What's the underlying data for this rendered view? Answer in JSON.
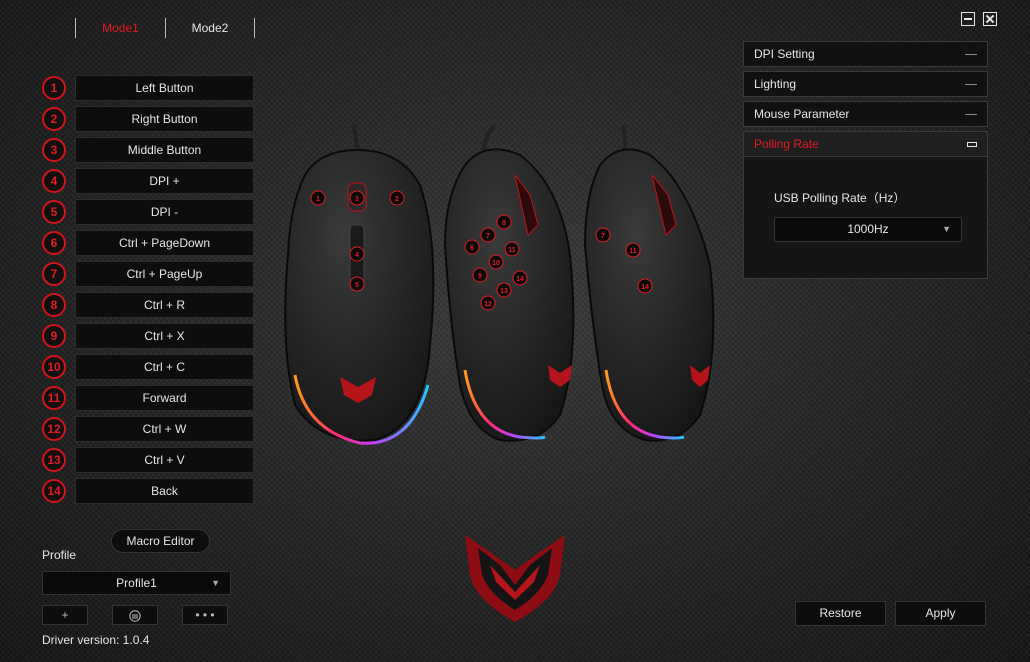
{
  "tabs": [
    {
      "label": "Mode1",
      "active": true
    },
    {
      "label": "Mode2",
      "active": false
    }
  ],
  "buttons": [
    {
      "num": "1",
      "action": "Left Button"
    },
    {
      "num": "2",
      "action": "Right Button"
    },
    {
      "num": "3",
      "action": "Middle Button"
    },
    {
      "num": "4",
      "action": "DPI +"
    },
    {
      "num": "5",
      "action": "DPI -"
    },
    {
      "num": "6",
      "action": "Ctrl + PageDown"
    },
    {
      "num": "7",
      "action": "Ctrl + PageUp"
    },
    {
      "num": "8",
      "action": "Ctrl + R"
    },
    {
      "num": "9",
      "action": "Ctrl + X"
    },
    {
      "num": "10",
      "action": "Ctrl + C"
    },
    {
      "num": "11",
      "action": "Forward"
    },
    {
      "num": "12",
      "action": "Ctrl + W"
    },
    {
      "num": "13",
      "action": "Ctrl + V"
    },
    {
      "num": "14",
      "action": "Back"
    }
  ],
  "mouse_labels": {
    "top": [
      "1",
      "2",
      "3",
      "4",
      "5"
    ],
    "side_left": [
      "6",
      "7",
      "8",
      "9",
      "10",
      "11",
      "12",
      "13",
      "14"
    ],
    "side_right": [
      "7",
      "11",
      "14"
    ]
  },
  "panel": {
    "sections": [
      {
        "label": "DPI Setting"
      },
      {
        "label": "Lighting"
      },
      {
        "label": "Mouse Parameter"
      }
    ],
    "open_section": {
      "label": "Polling Rate",
      "field_label": "USB Polling Rate（Hz）",
      "value": "1000Hz"
    }
  },
  "macro_label": "Macro Editor",
  "profile": {
    "label": "Profile",
    "value": "Profile1",
    "add_label": "+",
    "more_label": "• • •"
  },
  "version": "Driver version: 1.0.4",
  "restore_label": "Restore",
  "apply_label": "Apply",
  "colors": {
    "accent": "#e31b23",
    "panel_bg": "#111111",
    "text": "#e6e6e6"
  },
  "icons": [
    "minimize-icon",
    "close-icon",
    "trash-icon",
    "caret-down-icon",
    "brand-logo"
  ]
}
